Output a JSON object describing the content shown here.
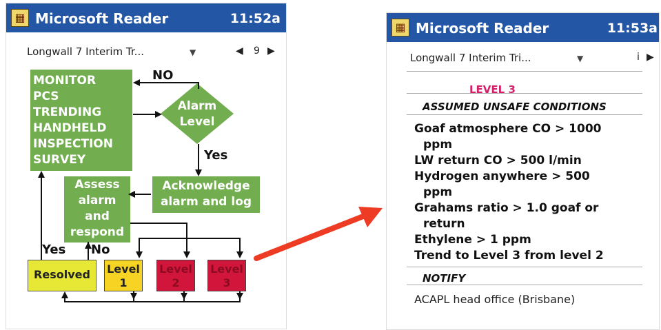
{
  "left_screen": {
    "app_title": "Microsoft Reader",
    "time": "11:52a",
    "book_title": "Longwall 7 Interim Tr...",
    "page_number": "9",
    "monitor_lines": [
      "MONITOR",
      "PCS",
      "TRENDING",
      "HANDHELD",
      "INSPECTION",
      "SURVEY"
    ],
    "diamond_lines": [
      "Alarm",
      "Level"
    ],
    "acknowledge_lines": [
      "Acknowledge",
      "alarm and log"
    ],
    "assess_lines": [
      "Assess",
      "alarm",
      "and",
      "respond"
    ],
    "label_no_top": "NO",
    "label_yes_mid": "Yes",
    "label_yes_bottom": "Yes",
    "label_no_bottom": "No",
    "resolved": "Resolved",
    "level1_lines": [
      "Level",
      "1"
    ],
    "level2_lines": [
      "Level",
      "2"
    ],
    "level3_lines": [
      "Level",
      "3"
    ]
  },
  "right_screen": {
    "app_title": "Microsoft Reader",
    "time": "11:53a",
    "book_title": "Longwall 7 Interim Tri...",
    "page_number": "i",
    "level_heading": "LEVEL 3",
    "conditions_heading": "ASSUMED UNSAFE CONDITIONS",
    "conditions": [
      "Goaf atmosphere CO > 1000",
      "ppm",
      "LW return CO > 500 l/min",
      "Hydrogen anywhere > 500",
      "ppm",
      "Grahams ratio > 1.0 goaf or",
      "return",
      "Ethylene > 1 ppm",
      "Trend to Level 3 from level 2"
    ],
    "notify_heading": "NOTIFY",
    "notify_text": "ACAPL head office (Brisbane)"
  },
  "icons": [
    "reader-app-icon",
    "dropdown-triangle-icon",
    "previous-page-icon",
    "next-page-icon",
    "connector-arrow-icon"
  ],
  "colors": {
    "titlebar": "#2456a6",
    "flow_green": "#72ad4f",
    "yellow": "#e7e735",
    "red": "#d2163b",
    "arrow": "#ee3b23",
    "level_text": "#d51f68"
  }
}
